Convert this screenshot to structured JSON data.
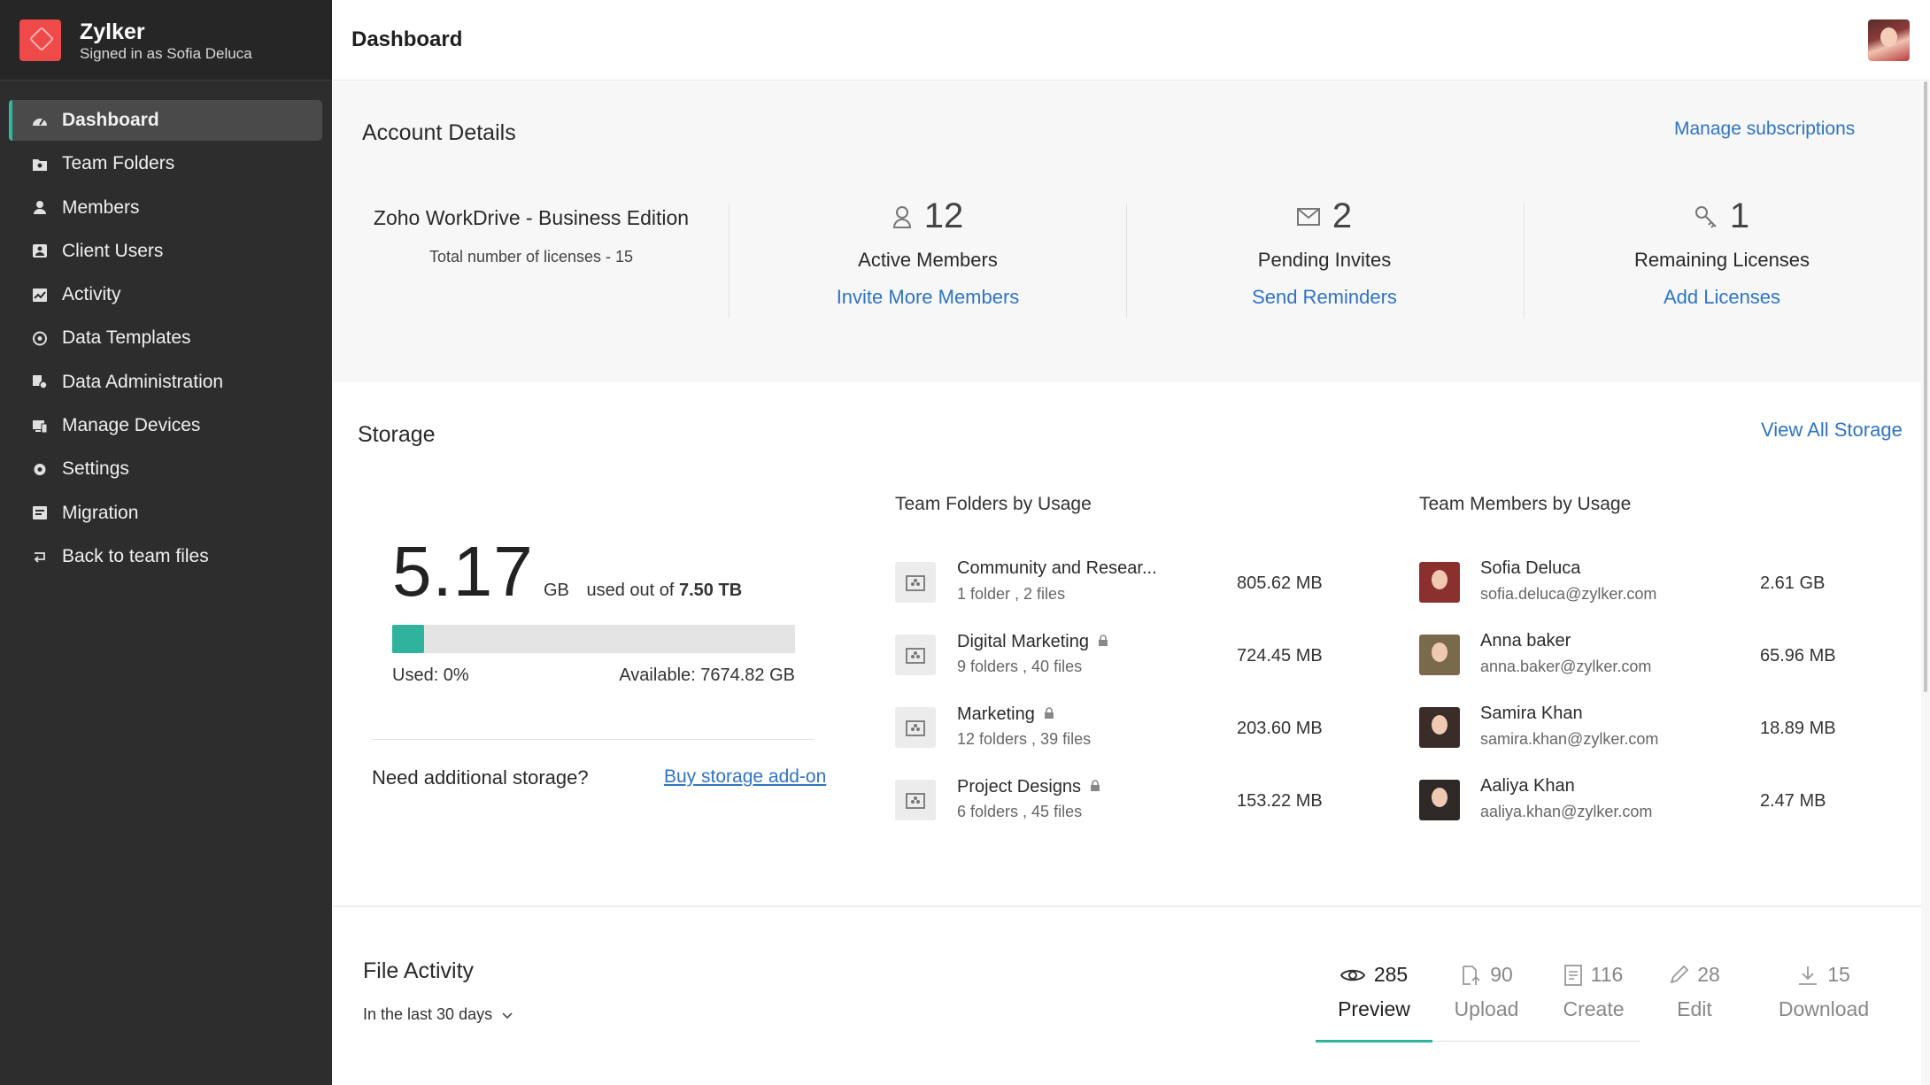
{
  "brand": {
    "name": "Zylker",
    "signed_in": "Signed in as Sofia Deluca"
  },
  "sidebar": {
    "items": [
      {
        "label": "Dashboard",
        "icon": "dashboard-icon",
        "active": true
      },
      {
        "label": "Team Folders",
        "icon": "team-folder-icon"
      },
      {
        "label": "Members",
        "icon": "members-icon"
      },
      {
        "label": "Client Users",
        "icon": "client-users-icon"
      },
      {
        "label": "Activity",
        "icon": "activity-icon"
      },
      {
        "label": "Data Templates",
        "icon": "data-templates-icon"
      },
      {
        "label": "Data Administration",
        "icon": "data-administration-icon"
      },
      {
        "label": "Manage Devices",
        "icon": "manage-devices-icon"
      },
      {
        "label": "Settings",
        "icon": "settings-icon"
      },
      {
        "label": "Migration",
        "icon": "migration-icon"
      },
      {
        "label": "Back to team files",
        "icon": "back-icon"
      }
    ]
  },
  "header": {
    "title": "Dashboard"
  },
  "account": {
    "title": "Account Details",
    "manage_link": "Manage subscriptions",
    "edition": "Zoho WorkDrive - Business Edition",
    "licenses_total": "Total number of licenses - 15",
    "stats": [
      {
        "count": "12",
        "label": "Active Members",
        "action": "Invite More Members",
        "icon": "user-icon"
      },
      {
        "count": "2",
        "label": "Pending Invites",
        "action": "Send Reminders",
        "icon": "mail-icon"
      },
      {
        "count": "1",
        "label": "Remaining Licenses",
        "action": "Add Licenses",
        "icon": "key-icon"
      }
    ]
  },
  "storage": {
    "title": "Storage",
    "view_all": "View All Storage",
    "used_value": "5.17",
    "used_unit": "GB",
    "used_out_of": "used out of",
    "total": "7.50 TB",
    "used_fraction": 0.08,
    "used_label": "Used: 0%",
    "available_label": "Available: 7674.82 GB",
    "need_more": "Need additional storage?",
    "buy_link": "Buy storage add-on",
    "folders_title": "Team Folders by Usage",
    "folders": [
      {
        "name": "Community and Resear...",
        "sub": "1 folder , 2 files",
        "size": "805.62 MB",
        "locked": false
      },
      {
        "name": "Digital Marketing",
        "sub": "9 folders , 40 files",
        "size": "724.45 MB",
        "locked": true
      },
      {
        "name": "Marketing",
        "sub": "12 folders , 39 files",
        "size": "203.60 MB",
        "locked": true
      },
      {
        "name": "Project Designs",
        "sub": "6 folders , 45 files",
        "size": "153.22 MB",
        "locked": true
      }
    ],
    "members_title": "Team Members by Usage",
    "members": [
      {
        "name": "Sofia Deluca",
        "email": "sofia.deluca@zylker.com",
        "size": "2.61 GB",
        "tone": "#8a3130"
      },
      {
        "name": "Anna baker",
        "email": "anna.baker@zylker.com",
        "size": "65.96 MB",
        "tone": "#7a6a4c"
      },
      {
        "name": "Samira Khan",
        "email": "samira.khan@zylker.com",
        "size": "18.89 MB",
        "tone": "#3a2c28"
      },
      {
        "name": "Aaliya Khan",
        "email": "aaliya.khan@zylker.com",
        "size": "2.47 MB",
        "tone": "#2e2826"
      }
    ]
  },
  "activity": {
    "title": "File Activity",
    "range": "In the last 30 days",
    "tabs": [
      {
        "count": "285",
        "label": "Preview",
        "icon": "eye-icon",
        "active": true
      },
      {
        "count": "90",
        "label": "Upload",
        "icon": "upload-icon"
      },
      {
        "count": "116",
        "label": "Create",
        "icon": "create-icon"
      },
      {
        "count": "28",
        "label": "Edit",
        "icon": "edit-icon"
      },
      {
        "count": "15",
        "label": "Download",
        "icon": "download-icon"
      }
    ]
  },
  "colors": {
    "accent": "#2fb39c",
    "link": "#2f74c0",
    "sidebar": "#2d2d2d",
    "brand": "#ee4a4a"
  }
}
